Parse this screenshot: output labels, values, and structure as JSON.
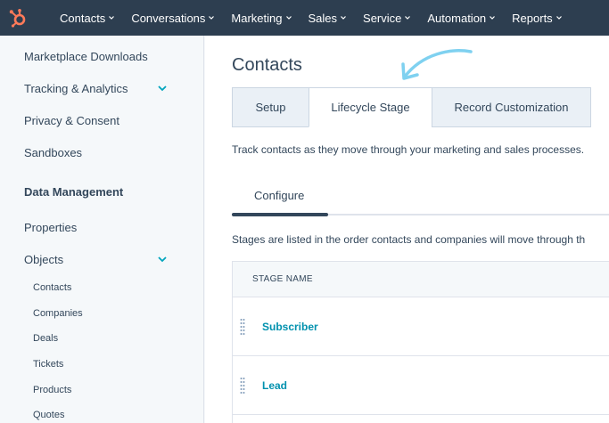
{
  "topnav": {
    "logo_icon": "hubspot-sprocket-icon",
    "brand_color": "#ff7a59",
    "background": "#2d3e50",
    "items": [
      {
        "label": "Contacts"
      },
      {
        "label": "Conversations"
      },
      {
        "label": "Marketing"
      },
      {
        "label": "Sales"
      },
      {
        "label": "Service"
      },
      {
        "label": "Automation"
      },
      {
        "label": "Reports"
      }
    ]
  },
  "sidebar": {
    "items": [
      {
        "label": "Marketplace Downloads"
      },
      {
        "label": "Tracking & Analytics"
      },
      {
        "label": "Privacy & Consent"
      },
      {
        "label": "Sandboxes"
      }
    ],
    "section_heading": "Data Management",
    "data_items": [
      {
        "label": "Properties"
      },
      {
        "label": "Objects"
      }
    ],
    "object_subitems": [
      {
        "label": "Contacts"
      },
      {
        "label": "Companies"
      },
      {
        "label": "Deals"
      },
      {
        "label": "Tickets"
      },
      {
        "label": "Products"
      },
      {
        "label": "Quotes"
      }
    ],
    "accent_color": "#00a4bd"
  },
  "main": {
    "title": "Contacts",
    "tabs": [
      {
        "label": "Setup"
      },
      {
        "label": "Lifecycle Stage"
      },
      {
        "label": "Record Customization"
      }
    ],
    "active_tab": "Lifecycle Stage",
    "description": "Track contacts as they move through your marketing and sales processes.",
    "subtab": "Configure",
    "stages_description": "Stages are listed in the order contacts and companies will move through th",
    "table": {
      "header": "STAGE NAME",
      "rows": [
        {
          "name": "Subscriber"
        },
        {
          "name": "Lead"
        }
      ]
    },
    "link_color": "#0091ae",
    "pointer_arrow_color": "#7fd1f0"
  }
}
